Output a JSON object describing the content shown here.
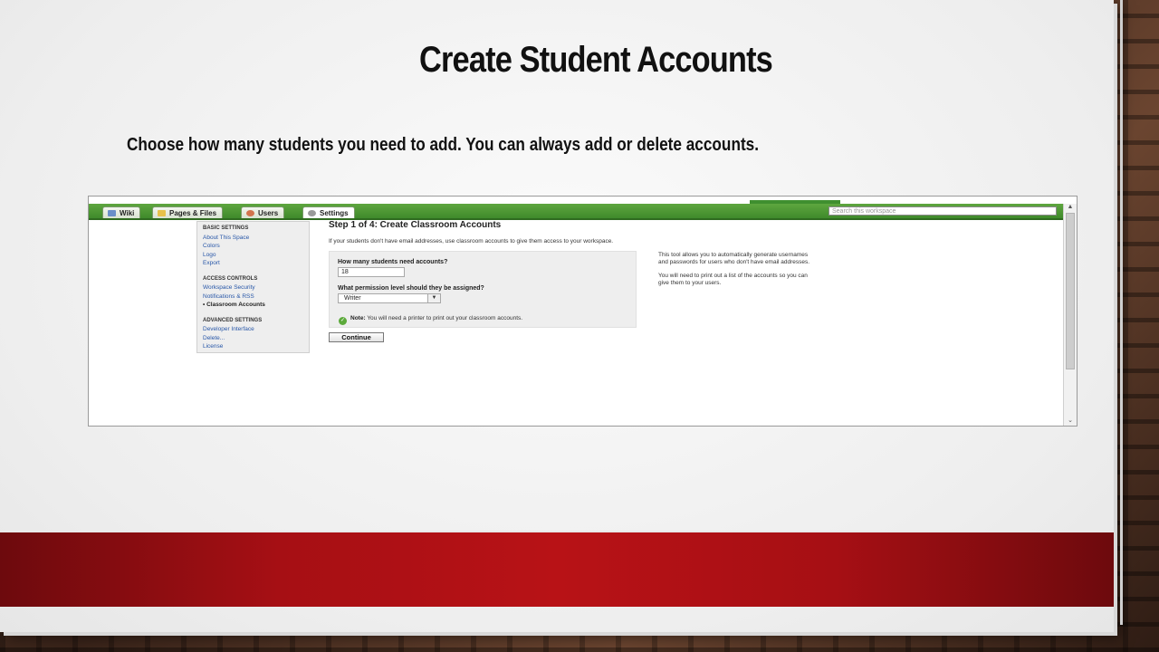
{
  "slide": {
    "title": "Create Student Accounts",
    "subtitle": "Choose how many students you need to add. You can always add or delete accounts."
  },
  "app": {
    "tabs": [
      {
        "label": "Wiki",
        "icon": "wiki-icon",
        "color": "#6a8fc9"
      },
      {
        "label": "Pages & Files",
        "icon": "folder-icon",
        "color": "#e6c14a"
      },
      {
        "label": "Users",
        "icon": "users-icon",
        "color": "#d2734d"
      },
      {
        "label": "Settings",
        "icon": "gear-icon",
        "color": "#9a9a9a"
      }
    ],
    "search_placeholder": "Search this workspace",
    "sidebar": {
      "basic_heading": "BASIC SETTINGS",
      "basic_items": [
        "About This Space",
        "Colors",
        "Logo",
        "Export"
      ],
      "access_heading": "ACCESS CONTROLS",
      "access_items": [
        "Workspace Security",
        "Notifications & RSS",
        "• Classroom Accounts"
      ],
      "advanced_heading": "ADVANCED SETTINGS",
      "advanced_items": [
        "Developer Interface",
        "Delete...",
        "License"
      ]
    },
    "main": {
      "title": "Step 1 of 4: Create Classroom Accounts",
      "intro": "If your students don't have email addresses, use classroom accounts to give them access to your workspace.",
      "q_count": "How many students need accounts?",
      "count_value": "18",
      "q_permission": "What permission level should they be assigned?",
      "permission_value": "Writer",
      "note_label": "Note:",
      "note_text": "You will need a printer to print out your classroom accounts.",
      "continue_label": "Continue",
      "help_1": "This tool allows you to automatically generate usernames and passwords for users who don't have email addresses.",
      "help_2": "You will need to print out a list of the accounts so you can give them to your users."
    }
  },
  "colors": {
    "accent_green": "#4f9a35",
    "band_red": "#b81216",
    "link_blue": "#2857a8"
  }
}
